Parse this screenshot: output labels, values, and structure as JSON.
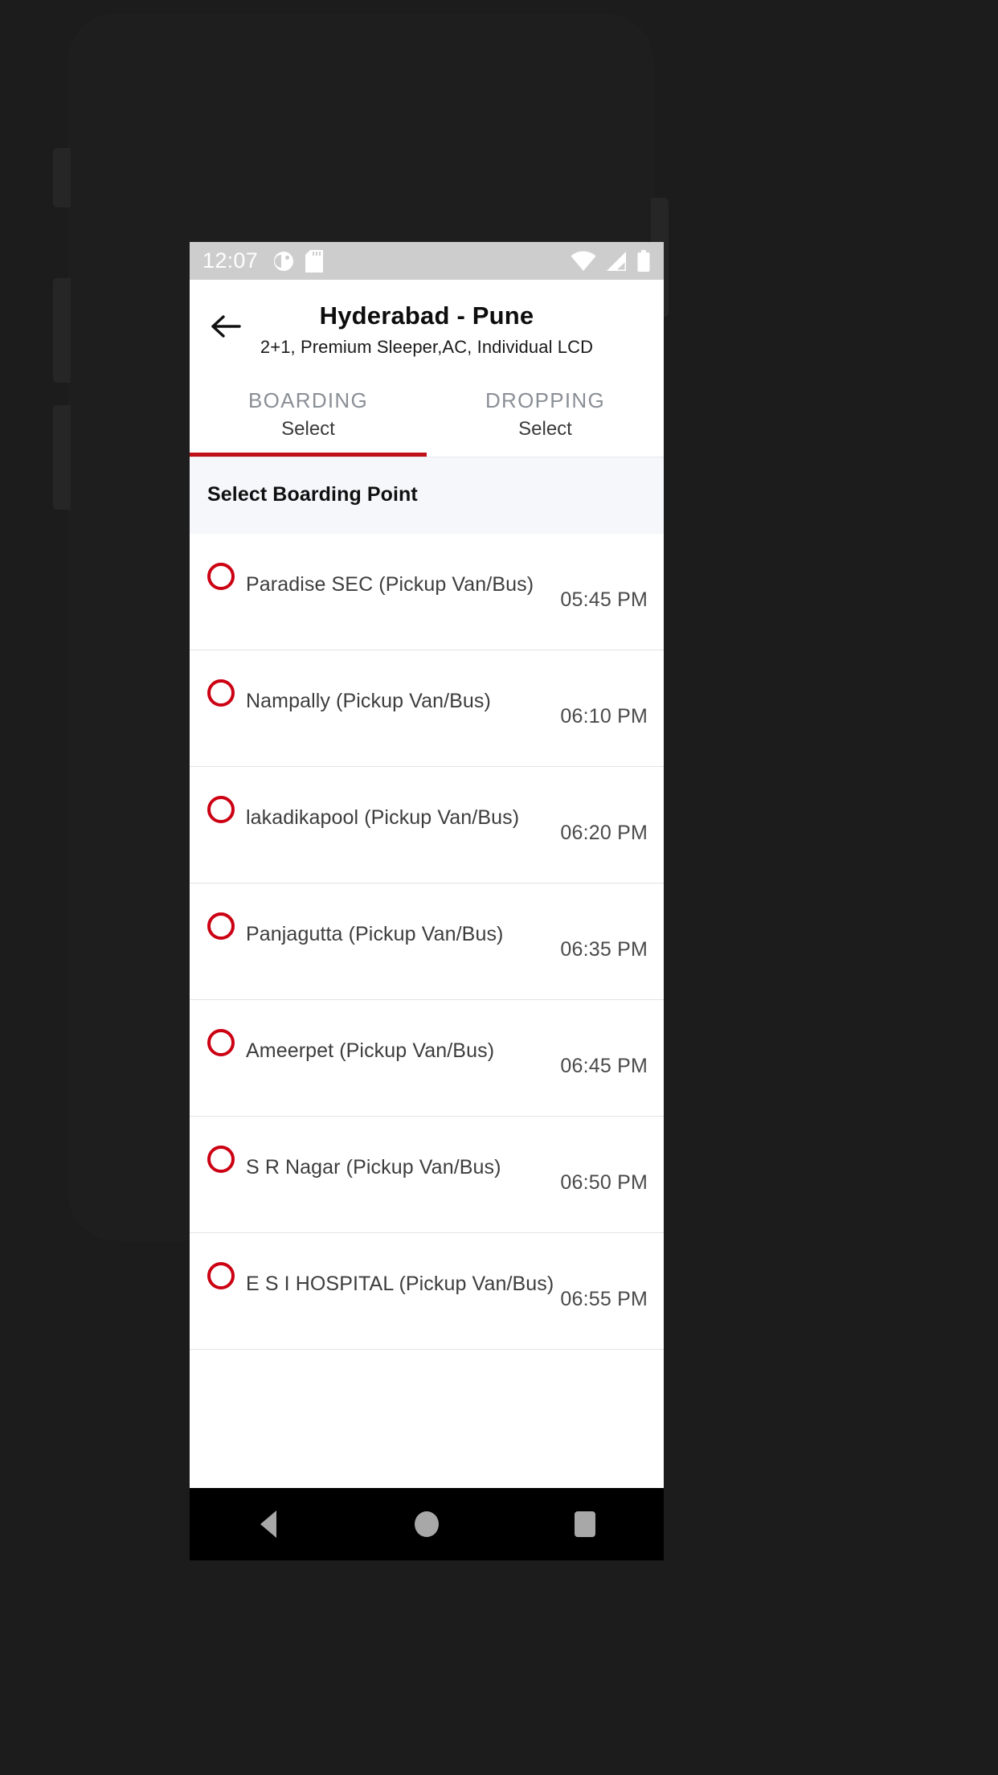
{
  "status_bar": {
    "time": "12:07",
    "left_icons": [
      "do-not-disturb-icon",
      "sd-card-icon"
    ],
    "right_icons": [
      "wifi-icon",
      "cellular-signal-icon",
      "battery-icon"
    ]
  },
  "app_bar": {
    "back_icon": "back-arrow-icon",
    "title": "Hyderabad - Pune",
    "subtitle": "2+1, Premium Sleeper,AC, Individual LCD"
  },
  "tabs": {
    "active_index": 0,
    "indicator_color": "#c01118",
    "items": [
      {
        "title": "BOARDING",
        "value": "Select"
      },
      {
        "title": "DROPPING",
        "value": "Select"
      }
    ]
  },
  "section": {
    "header": "Select Boarding Point"
  },
  "boarding_points": [
    {
      "name": "Paradise SEC (Pickup Van/Bus)",
      "time": "05:45 PM",
      "selected": false
    },
    {
      "name": "Nampally (Pickup Van/Bus)",
      "time": "06:10 PM",
      "selected": false
    },
    {
      "name": "lakadikapool (Pickup Van/Bus)",
      "time": "06:20 PM",
      "selected": false
    },
    {
      "name": "Panjagutta (Pickup Van/Bus)",
      "time": "06:35 PM",
      "selected": false
    },
    {
      "name": "Ameerpet (Pickup Van/Bus)",
      "time": "06:45 PM",
      "selected": false
    },
    {
      "name": "S R Nagar (Pickup Van/Bus)",
      "time": "06:50 PM",
      "selected": false
    },
    {
      "name": "E S I HOSPITAL (Pickup Van/Bus)",
      "time": "06:55 PM",
      "selected": false
    }
  ],
  "nav_bar": {
    "back_icon": "triangle-back-icon",
    "home_icon": "circle-home-icon",
    "recents_icon": "square-recents-icon"
  },
  "colors": {
    "accent_red": "#cc0013",
    "status_bar_bg": "#cdcdcd",
    "section_bg": "#f5f7fa"
  }
}
